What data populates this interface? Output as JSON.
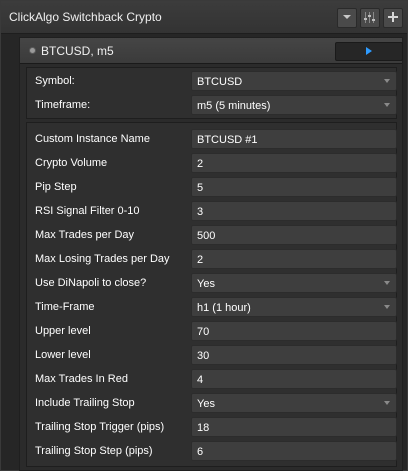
{
  "window": {
    "title": "ClickAlgo Switchback Crypto"
  },
  "instance": {
    "title": "BTCUSD, m5"
  },
  "symbol_section": {
    "rows": [
      {
        "label": "Symbol:",
        "value": "BTCUSD",
        "type": "select"
      },
      {
        "label": "Timeframe:",
        "value": "m5 (5 minutes)",
        "type": "select"
      }
    ]
  },
  "params": {
    "rows": [
      {
        "label": "Custom Instance Name",
        "value": "BTCUSD #1",
        "type": "text"
      },
      {
        "label": "Crypto Volume",
        "value": "2",
        "type": "number"
      },
      {
        "label": "Pip Step",
        "value": "5",
        "type": "number"
      },
      {
        "label": "RSI Signal Filter 0-10",
        "value": "3",
        "type": "number"
      },
      {
        "label": "Max Trades per Day",
        "value": "500",
        "type": "number"
      },
      {
        "label": "Max Losing Trades per Day",
        "value": "2",
        "type": "number"
      },
      {
        "label": "Use DiNapoli to close?",
        "value": "Yes",
        "type": "select"
      },
      {
        "label": "Time-Frame",
        "value": "h1 (1 hour)",
        "type": "select"
      },
      {
        "label": "Upper level",
        "value": "70",
        "type": "number"
      },
      {
        "label": "Lower level",
        "value": "30",
        "type": "number"
      },
      {
        "label": "Max Trades In Red",
        "value": "4",
        "type": "number"
      },
      {
        "label": "Include Trailing Stop",
        "value": "Yes",
        "type": "select"
      },
      {
        "label": "Trailing Stop Trigger (pips)",
        "value": "18",
        "type": "number"
      },
      {
        "label": "Trailing Stop Step (pips)",
        "value": "6",
        "type": "number"
      }
    ]
  },
  "icons": {
    "menu": "chevron-down-icon",
    "settings": "sliders-icon",
    "add": "plus-icon",
    "play": "play-icon",
    "status": "status-dot-icon"
  },
  "colors": {
    "play_accent": "#2e9bff",
    "panel_bg": "#2f2f2f",
    "field_bg": "#3e3e3e"
  }
}
